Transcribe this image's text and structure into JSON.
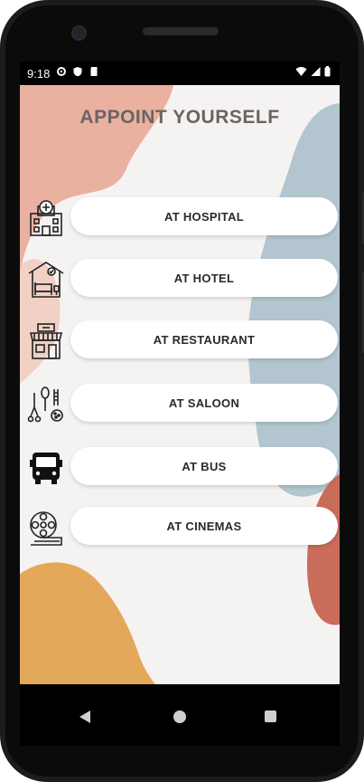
{
  "status": {
    "time": "9:18"
  },
  "app": {
    "title": "APPOINT YOURSELF"
  },
  "options": [
    {
      "label": "AT HOSPITAL",
      "icon": "hospital-icon"
    },
    {
      "label": "AT HOTEL",
      "icon": "hotel-icon"
    },
    {
      "label": "AT RESTAURANT",
      "icon": "restaurant-icon"
    },
    {
      "label": "AT SALOON",
      "icon": "saloon-icon"
    },
    {
      "label": "AT BUS",
      "icon": "bus-icon"
    },
    {
      "label": "AT CINEMAS",
      "icon": "cinema-icon"
    }
  ],
  "colors": {
    "blob_pink": "#e9a897",
    "blob_blue": "#b3c6cf",
    "blob_rust": "#c96d5a",
    "blob_yellow": "#e3a85a",
    "background": "#f5f3f1"
  }
}
